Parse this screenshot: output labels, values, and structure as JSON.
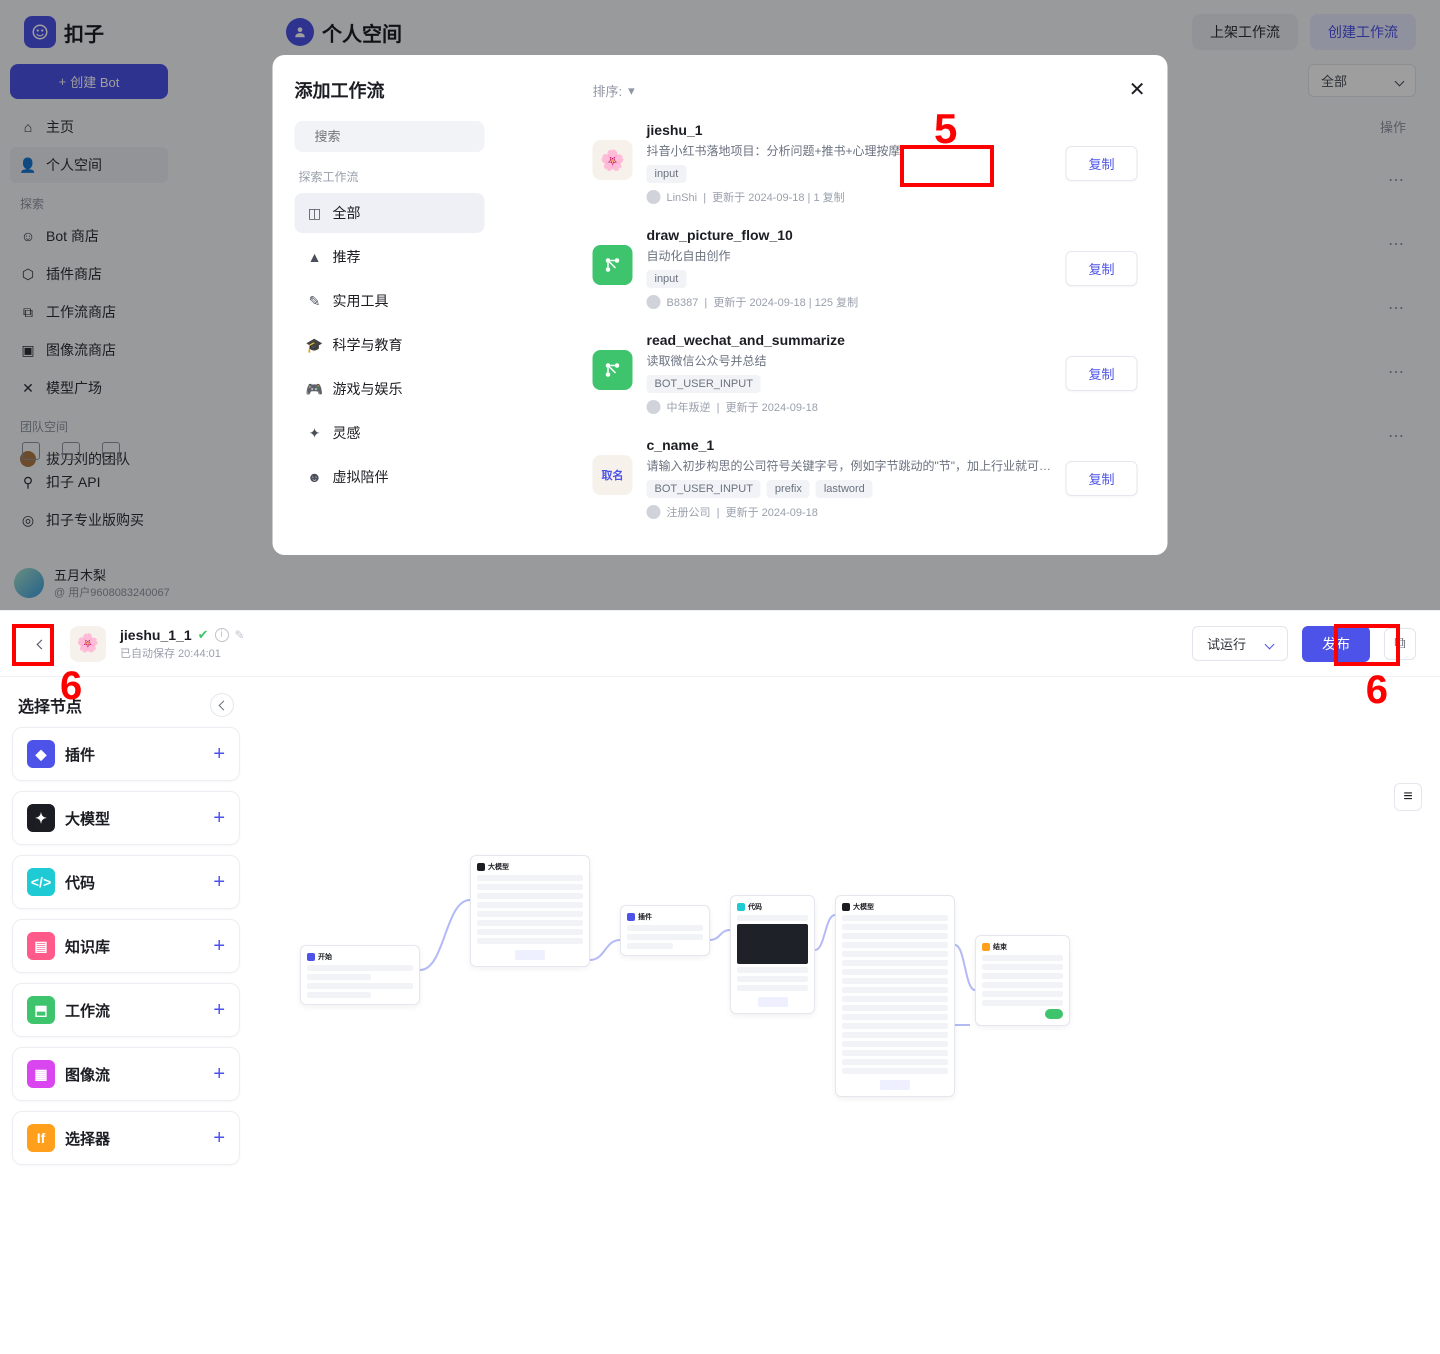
{
  "app": {
    "logo_text": "扣子",
    "workspace_title": "个人空间",
    "publish_btn": "上架工作流",
    "create_btn": "创建工作流"
  },
  "sidebar": {
    "create_bot": "创建 Bot",
    "home": "主页",
    "personal": "个人空间",
    "explore_label": "探索",
    "bot_store": "Bot 商店",
    "plugin_store": "插件商店",
    "workflow_store": "工作流商店",
    "imageflow_store": "图像流商店",
    "model_square": "模型广场",
    "team_label": "团队空间",
    "team_item": "拔刀刘的团队",
    "api_link": "扣子 API",
    "pro_link": "扣子专业版购买",
    "user_name": "五月木梨",
    "user_id": "@ 用户9608083240067"
  },
  "main_bg": {
    "filter_all": "全部",
    "col_op": "操作"
  },
  "modal": {
    "title": "添加工作流",
    "search_placeholder": "搜索",
    "explore_label": "探索工作流",
    "sort_label": "排序:",
    "categories": {
      "all": "全部",
      "recommend": "推荐",
      "tools": "实用工具",
      "science": "科学与教育",
      "game": "游戏与娱乐",
      "inspire": "灵感",
      "companion": "虚拟陪伴"
    },
    "copy_label": "复制",
    "workflows": [
      {
        "name": "jieshu_1",
        "desc": "抖音小红书落地项目：分析问题+推书+心理按摩",
        "tags": [
          "input"
        ],
        "author": "LinShi",
        "date": "更新于 2024-09-18",
        "copies": "1 复制",
        "icon": "pale"
      },
      {
        "name": "draw_picture_flow_10",
        "desc": "自动化自由创作",
        "tags": [
          "input"
        ],
        "author": "B8387",
        "date": "更新于 2024-09-18",
        "copies": "125 复制",
        "icon": "green"
      },
      {
        "name": "read_wechat_and_summarize",
        "desc": "读取微信公众号并总结",
        "tags": [
          "BOT_USER_INPUT"
        ],
        "author": "中年叛逆",
        "date": "更新于 2024-09-18",
        "copies": "",
        "icon": "green"
      },
      {
        "name": "c_name_1",
        "desc": "请输入初步构思的公司符号关键字号，例如字节跳动的\"节\"，加上行业就可以让大模型帮您取一个根据关键字推算出来的公司…",
        "tags": [
          "BOT_USER_INPUT",
          "prefix",
          "lastword"
        ],
        "author": "注册公司",
        "date": "更新于 2024-09-18",
        "copies": "",
        "icon": "pale"
      }
    ]
  },
  "editor": {
    "flow_name": "jieshu_1_1",
    "saved_status": "已自动保存 20:44:01",
    "run_btn": "试运行",
    "publish_btn": "发布",
    "panel_title": "选择节点",
    "nodes": [
      {
        "label": "插件",
        "color": "blue"
      },
      {
        "label": "大模型",
        "color": "black"
      },
      {
        "label": "代码",
        "color": "teal"
      },
      {
        "label": "知识库",
        "color": "pink"
      },
      {
        "label": "工作流",
        "color": "green"
      },
      {
        "label": "图像流",
        "color": "magenta"
      },
      {
        "label": "选择器",
        "color": "orange"
      }
    ]
  },
  "annotations": {
    "five": "5",
    "six_left": "6",
    "six_right": "6"
  }
}
